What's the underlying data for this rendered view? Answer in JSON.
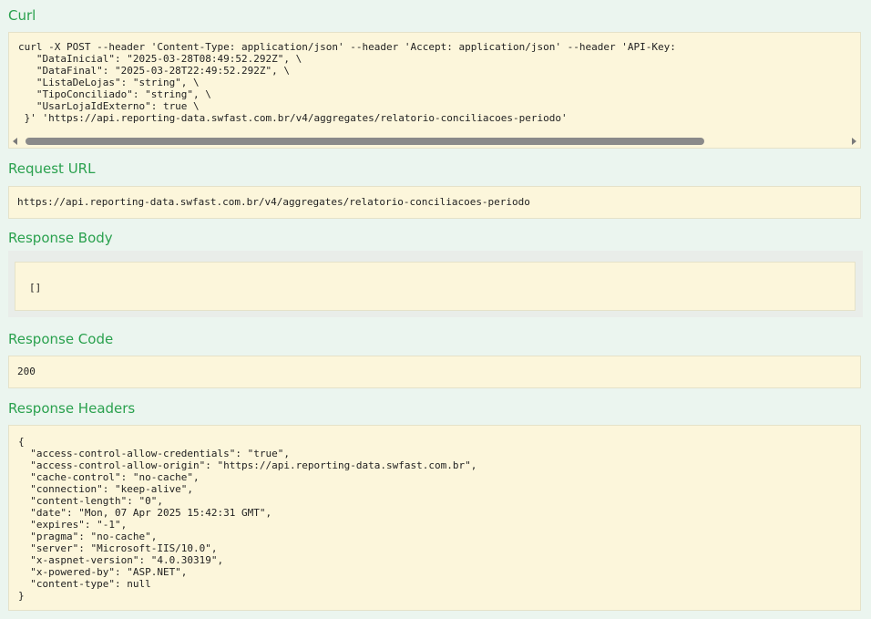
{
  "sections": {
    "curl_title": "Curl",
    "request_url_title": "Request URL",
    "response_body_title": "Response Body",
    "response_code_title": "Response Code",
    "response_headers_title": "Response Headers"
  },
  "curl": {
    "command": "curl -X POST --header 'Content-Type: application/json' --header 'Accept: application/json' --header 'API-Key: \n   \"DataInicial\": \"2025-03-28T08:49:52.292Z\", \\\n   \"DataFinal\": \"2025-03-28T22:49:52.292Z\", \\\n   \"ListaDeLojas\": \"string\", \\\n   \"TipoConciliado\": \"string\", \\\n   \"UsarLojaIdExterno\": true \\\n }' 'https://api.reporting-data.swfast.com.br/v4/aggregates/relatorio-conciliacoes-periodo'"
  },
  "request_url": "https://api.reporting-data.swfast.com.br/v4/aggregates/relatorio-conciliacoes-periodo",
  "response_body": "[]",
  "response_code": "200",
  "response_headers": "{\n  \"access-control-allow-credentials\": \"true\",\n  \"access-control-allow-origin\": \"https://api.reporting-data.swfast.com.br\",\n  \"cache-control\": \"no-cache\",\n  \"connection\": \"keep-alive\",\n  \"content-length\": \"0\",\n  \"date\": \"Mon, 07 Apr 2025 15:42:31 GMT\",\n  \"expires\": \"-1\",\n  \"pragma\": \"no-cache\",\n  \"server\": \"Microsoft-IIS/10.0\",\n  \"x-aspnet-version\": \"4.0.30319\",\n  \"x-powered-by\": \"ASP.NET\",\n  \"content-type\": null\n}"
}
